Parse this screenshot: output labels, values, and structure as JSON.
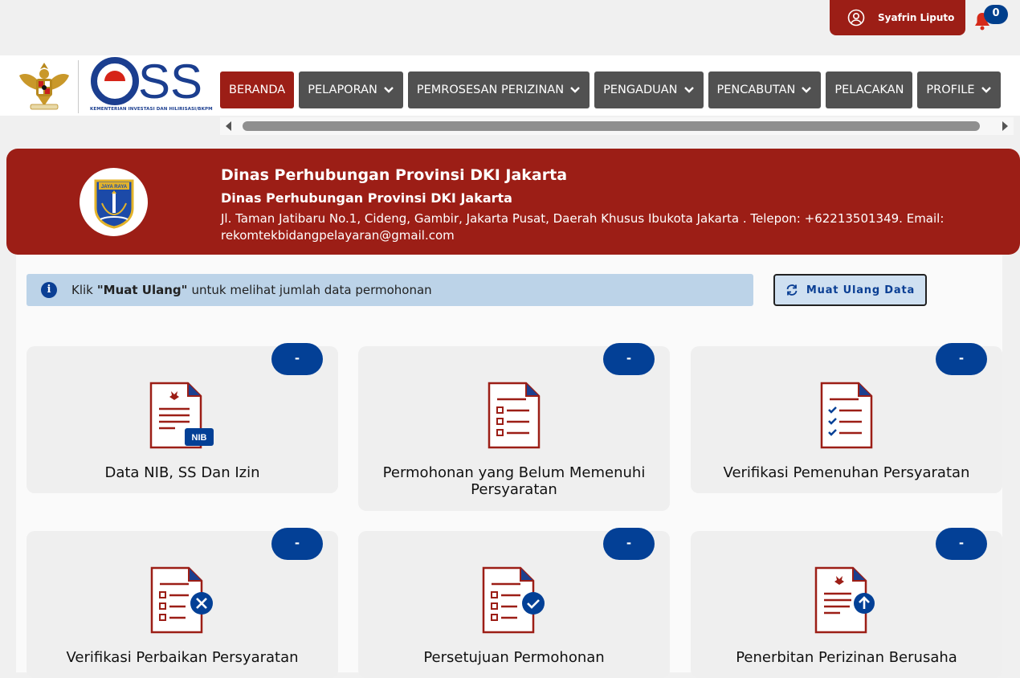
{
  "topbar": {
    "user_name": "Syafrin Liputo",
    "notif_count": "0"
  },
  "logo": {
    "brand": "OSS",
    "subtitle": "KEMENTERIAN INVESTASI DAN HILIRISASI/BKPM"
  },
  "nav": {
    "items": [
      {
        "label": "BERANDA",
        "active": true,
        "dropdown": false
      },
      {
        "label": "PELAPORAN",
        "active": false,
        "dropdown": true
      },
      {
        "label": "PEMROSESAN PERIZINAN",
        "active": false,
        "dropdown": true
      },
      {
        "label": "PENGADUAN",
        "active": false,
        "dropdown": true
      },
      {
        "label": "PENCABUTAN",
        "active": false,
        "dropdown": true
      },
      {
        "label": "PELACAKAN",
        "active": false,
        "dropdown": false
      },
      {
        "label": "PROFILE",
        "active": false,
        "dropdown": true
      }
    ]
  },
  "agency": {
    "name": "Dinas Perhubungan Provinsi DKI Jakarta",
    "unit": "Dinas Perhubungan Provinsi DKI Jakarta",
    "address": "Jl. Taman Jatibaru No.1, Cideng, Gambir, Jakarta Pusat, Daerah Khusus Ibukota Jakarta . Telepon: +62213501349. Email: rekomtekbidangpelayaran@gmail.com",
    "logo_text": "JAYA RAYA"
  },
  "info": {
    "prefix": "Klik",
    "highlight": "\"Muat Ulang\"",
    "suffix": "untuk melihat jumlah data permohonan"
  },
  "reload_button": {
    "label": "Muat Ulang Data"
  },
  "cards": [
    {
      "label": "Data NIB, SS Dan Izin",
      "count": "-"
    },
    {
      "label": "Permohonan yang Belum Memenuhi Persyaratan",
      "count": "-"
    },
    {
      "label": "Verifikasi Pemenuhan Persyaratan",
      "count": "-"
    },
    {
      "label": "Verifikasi Perbaikan Persyaratan",
      "count": "-"
    },
    {
      "label": "Persetujuan Permohonan",
      "count": "-"
    },
    {
      "label": "Penerbitan Perizinan Berusaha",
      "count": "-"
    }
  ],
  "colors": {
    "brand_red": "#9c1e16",
    "brand_blue": "#034096",
    "nav_gray": "#515151"
  }
}
